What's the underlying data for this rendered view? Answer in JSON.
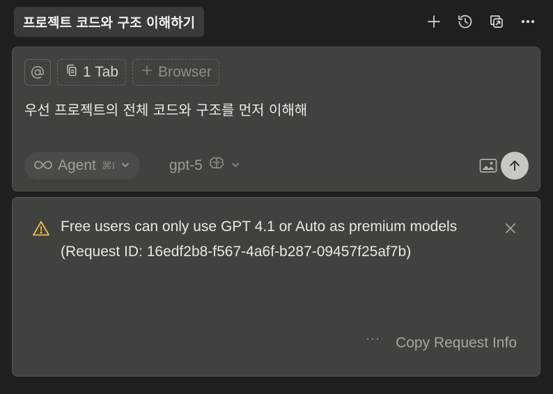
{
  "header": {
    "title": "프로젝트 코드와 구조 이해하기",
    "icons": [
      "plus-icon",
      "history-icon",
      "copy-open-icon",
      "more-icon"
    ]
  },
  "composer": {
    "context_chips": {
      "at_icon": "at-icon",
      "tabs_label": "1 Tab",
      "browser_label": "Browser"
    },
    "prompt": "우선 프로젝트의 전체 코드와 구조를 먼저 이해해",
    "mode": {
      "label": "Agent",
      "shortcut": "⌘I"
    },
    "model": {
      "label": "gpt-5"
    }
  },
  "error": {
    "message": "Free users can only use GPT 4.1 or Auto as premium models",
    "request_id": "(Request ID: 16edf2b8-f567-4a6f-b287-09457f25af7b)",
    "copy_label": "Copy Request Info",
    "more_label": "···"
  },
  "colors": {
    "background": "#1f1f1d",
    "panel": "#41413d",
    "warning": "#e6c34a",
    "send_button": "#c8c8c3"
  }
}
